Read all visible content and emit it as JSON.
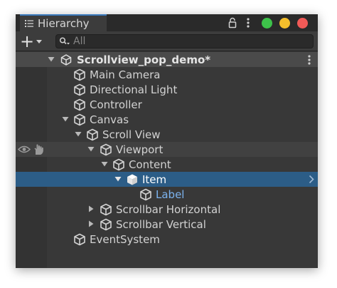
{
  "panel": {
    "tab_title": "Hierarchy",
    "tab_icon": "list-icon",
    "window_controls": [
      {
        "name": "close",
        "color": "#3dc24a"
      },
      {
        "name": "minimize",
        "color": "#f5bf2c"
      },
      {
        "name": "zoom",
        "color": "#f25a57"
      }
    ]
  },
  "toolbar": {
    "add_label": "+",
    "search_placeholder": "All"
  },
  "colors": {
    "accent_tab": "#3a79bb",
    "selection": "#2c5d87",
    "prefab_text": "#7cb3ef"
  },
  "tree": {
    "scene": {
      "label": "Scrollview_pop_demo*",
      "icon": "unity-logo-icon"
    },
    "nodes": [
      {
        "label": "Main Camera",
        "icon": "cube-icon"
      },
      {
        "label": "Directional Light",
        "icon": "cube-icon"
      },
      {
        "label": "Controller",
        "icon": "cube-icon"
      },
      {
        "label": "Canvas",
        "icon": "cube-icon",
        "expanded": true
      },
      {
        "label": "Scroll View",
        "icon": "cube-icon",
        "expanded": true
      },
      {
        "label": "Viewport",
        "icon": "cube-icon",
        "expanded": true
      },
      {
        "label": "Content",
        "icon": "cube-icon",
        "expanded": true
      },
      {
        "label": "Item",
        "icon": "cube-icon",
        "expanded": true,
        "selected": true
      },
      {
        "label": "Label",
        "icon": "cube-icon"
      },
      {
        "label": "Scrollbar Horizontal",
        "icon": "cube-icon",
        "expanded": false
      },
      {
        "label": "Scrollbar Vertical",
        "icon": "cube-icon",
        "expanded": false
      },
      {
        "label": "EventSystem",
        "icon": "cube-icon"
      }
    ]
  }
}
